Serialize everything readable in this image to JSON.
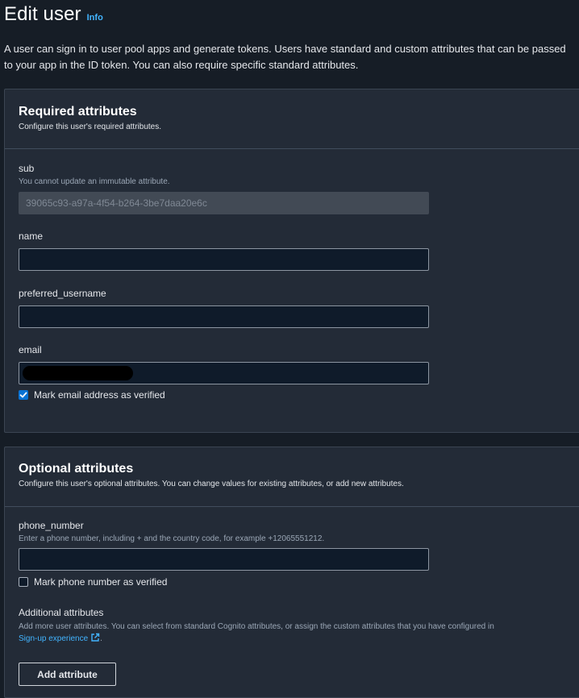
{
  "header": {
    "title": "Edit user",
    "info_link": "Info",
    "description": "A user can sign in to user pool apps and generate tokens. Users have standard and custom attributes that can be passed to your app in the ID token. You can also require specific standard attributes."
  },
  "required": {
    "title": "Required attributes",
    "subtitle": "Configure this user's required attributes.",
    "sub": {
      "label": "sub",
      "help": "You cannot update an immutable attribute.",
      "value": "39065c93-a97a-4f54-b264-3be7daa20e6c"
    },
    "name": {
      "label": "name",
      "value": ""
    },
    "preferred_username": {
      "label": "preferred_username",
      "value": ""
    },
    "email": {
      "label": "email",
      "value_redacted": true,
      "verified_label": "Mark email address as verified",
      "verified_checked": true
    }
  },
  "optional": {
    "title": "Optional attributes",
    "subtitle": "Configure this user's optional attributes. You can change values for existing attributes, or add new attributes.",
    "phone": {
      "label": "phone_number",
      "help": "Enter a phone number, including + and the country code, for example +12065551212.",
      "value": "",
      "verified_label": "Mark phone number as verified",
      "verified_checked": false
    },
    "additional": {
      "label": "Additional attributes",
      "help_prefix": "Add more user attributes. You can select from standard Cognito attributes, or assign the custom attributes that you have configured in",
      "help_link": "Sign-up experience",
      "help_suffix": ".",
      "link_icon": "external-link-icon"
    },
    "add_button": "Add attribute"
  },
  "colors": {
    "background": "#161d26",
    "panel": "#232b37",
    "accent_link": "#42b4ff",
    "checkbox_checked": "#0972d3"
  }
}
